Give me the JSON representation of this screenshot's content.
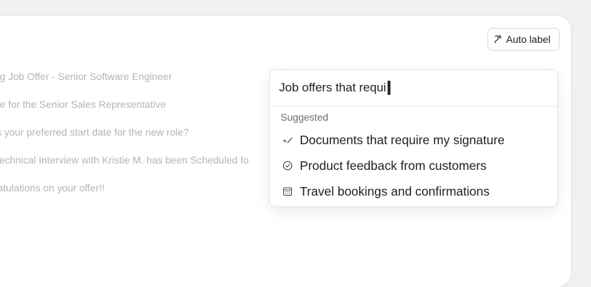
{
  "toolbar": {
    "auto_label": "Auto label"
  },
  "emails": [
    {
      "subject": "ng Job Offer - Senior Software Engineer"
    },
    {
      "subject": "ne for the Senior Sales Representative"
    },
    {
      "subject": " is your preferred start date for the new role?"
    },
    {
      "subject": "Technical Interview with Kristie M. has been Scheduled fo"
    },
    {
      "subject": "ratulations on your offer!!"
    }
  ],
  "search": {
    "query": "Job offers that requi",
    "suggested_header": "Suggested",
    "suggestions": [
      {
        "label": "Documents that require my signature",
        "icon": "signature-icon"
      },
      {
        "label": "Product feedback from customers",
        "icon": "check-circle-icon"
      },
      {
        "label": "Travel bookings and confirmations",
        "icon": "calendar-icon"
      }
    ]
  }
}
